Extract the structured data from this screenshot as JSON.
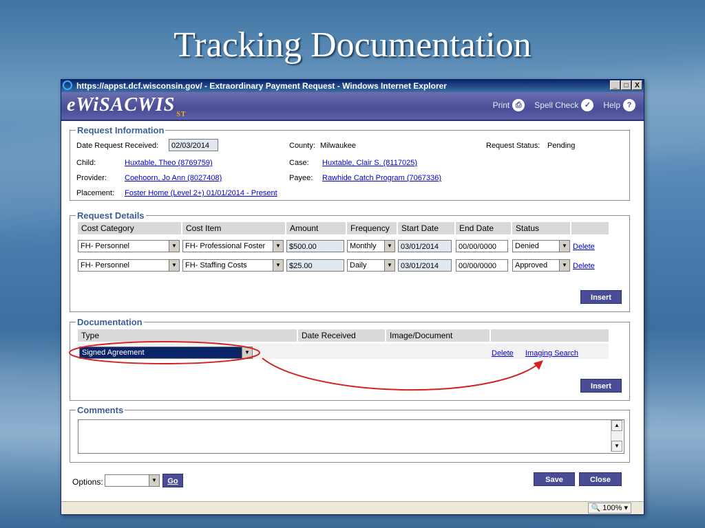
{
  "slide_title": "Tracking Documentation",
  "window": {
    "title": "https://appst.dcf.wisconsin.gov/ - Extraordinary Payment Request - Windows Internet Explorer",
    "minimize": "_",
    "maximize": "□",
    "close": "X"
  },
  "app": {
    "logo": "eWiSACWIS",
    "logo_sub": "ST",
    "print_label": "Print",
    "spell_label": "Spell Check",
    "help_label": "Help"
  },
  "request_info": {
    "legend": "Request Information",
    "date_received_label": "Date Request Received:",
    "date_received_value": "02/03/2014",
    "county_label": "County:",
    "county_value": "Milwaukee",
    "status_label": "Request Status:",
    "status_value": "Pending",
    "child_label": "Child:",
    "child_value": "Huxtable, Theo (8769759)",
    "case_label": "Case:",
    "case_value": "Huxtable, Clair S. (8117025)",
    "provider_label": "Provider:",
    "provider_value": "Coehoorn, Jo Ann (8027408)",
    "payee_label": "Payee:",
    "payee_value": "Rawhide Catch Program (7067336)",
    "placement_label": "Placement:",
    "placement_value": "Foster Home (Level 2+) 01/01/2014 - Present"
  },
  "request_details": {
    "legend": "Request Details",
    "columns": [
      "Cost Category",
      "Cost Item",
      "Amount",
      "Frequency",
      "Start Date",
      "End Date",
      "Status"
    ],
    "rows": [
      {
        "category": "FH- Personnel",
        "item": "FH- Professional Foster",
        "amount": "$500.00",
        "frequency": "Monthly",
        "start": "03/01/2014",
        "end": "00/00/0000",
        "status": "Denied",
        "action": "Delete"
      },
      {
        "category": "FH- Personnel",
        "item": "FH- Staffing Costs",
        "amount": "$25.00",
        "frequency": "Daily",
        "start": "03/01/2014",
        "end": "00/00/0000",
        "status": "Approved",
        "action": "Delete"
      }
    ],
    "insert_label": "Insert"
  },
  "documentation": {
    "legend": "Documentation",
    "columns": [
      "Type",
      "Date Received",
      "Image/Document"
    ],
    "row": {
      "type": "Signed Agreement",
      "delete": "Delete",
      "imaging": "Imaging Search"
    },
    "insert_label": "Insert"
  },
  "comments": {
    "legend": "Comments",
    "value": ""
  },
  "footer": {
    "options_label": "Options:",
    "options_value": "",
    "go_label": "Go",
    "save_label": "Save",
    "close_label": "Close"
  },
  "statusbar": {
    "zoom": "100%"
  },
  "colors": {
    "accent": "#4a4d95",
    "annotation": "#d42020",
    "link": "#0000cc"
  }
}
